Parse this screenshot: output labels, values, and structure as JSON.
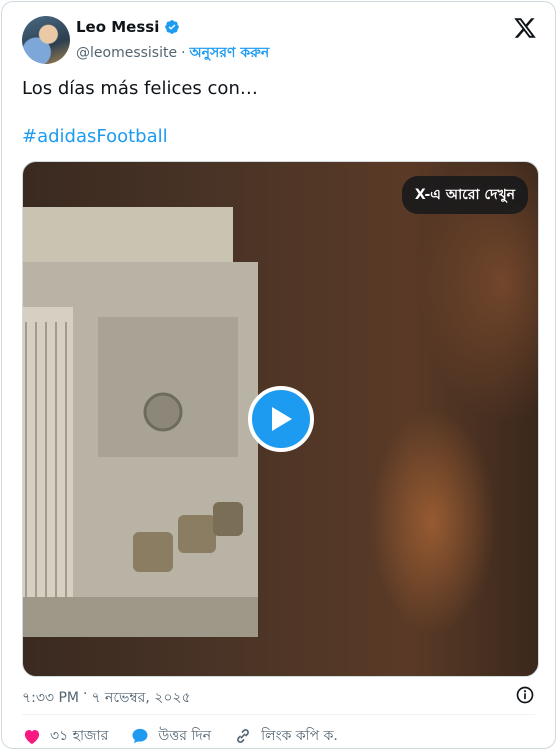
{
  "author": {
    "name": "Leo Messi",
    "handle": "@leomessisite",
    "separator": "·",
    "follow_label": "অনুসরণ করুন"
  },
  "tweet": {
    "text": "Los días más felices con…",
    "hashtag": "#adidasFootball"
  },
  "media": {
    "see_more_label": "X-এ আরো দেখুন"
  },
  "meta": {
    "time": "৭:৩৩ PM",
    "separator": "·",
    "date": "৭ নভেম্বর, ২০২৫"
  },
  "actions": {
    "likes": "৩১ হাজার",
    "reply": "উত্তর দিন",
    "copy_link": "লিংক কপি ক."
  },
  "colors": {
    "accent": "#1d9bf0",
    "like": "#f91880",
    "text": "#0f1419",
    "secondary": "#536471"
  },
  "icons": [
    "verified-badge-icon",
    "x-logo-icon",
    "play-icon",
    "info-icon",
    "heart-icon",
    "reply-icon",
    "link-icon"
  ]
}
